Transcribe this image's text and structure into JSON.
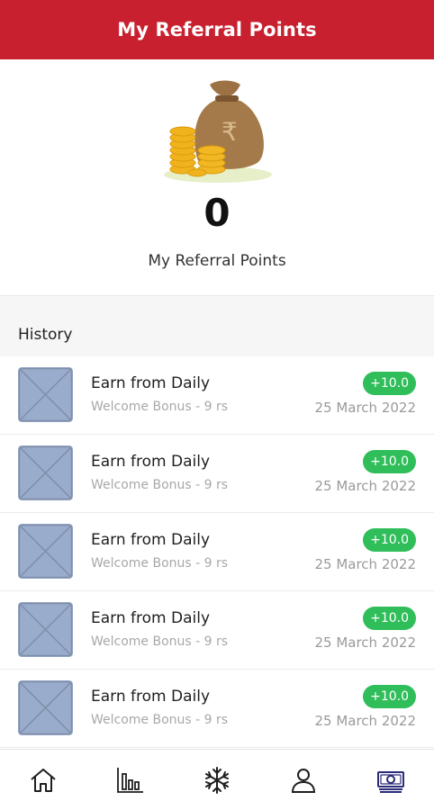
{
  "app_bar": {
    "title": "My Referral Points"
  },
  "summary": {
    "points": "0",
    "label": "My Referral Points"
  },
  "history": {
    "heading": "History",
    "items": [
      {
        "title": "Earn from Daily",
        "subtitle": "Welcome Bonus - 9 rs",
        "amount": "+10.0",
        "date": "25 March 2022"
      },
      {
        "title": "Earn from Daily",
        "subtitle": "Welcome Bonus - 9 rs",
        "amount": "+10.0",
        "date": "25 March 2022"
      },
      {
        "title": "Earn from Daily",
        "subtitle": "Welcome Bonus - 9 rs",
        "amount": "+10.0",
        "date": "25 March 2022"
      },
      {
        "title": "Earn from Daily",
        "subtitle": "Welcome Bonus - 9 rs",
        "amount": "+10.0",
        "date": "25 March 2022"
      },
      {
        "title": "Earn from Daily",
        "subtitle": "Welcome Bonus - 9 rs",
        "amount": "+10.0",
        "date": "25 March 2022"
      }
    ]
  },
  "bottom_nav": {
    "items": [
      {
        "icon": "home-icon",
        "active": false
      },
      {
        "icon": "bar-chart-icon",
        "active": false
      },
      {
        "icon": "snowflake-icon",
        "active": false
      },
      {
        "icon": "user-icon",
        "active": false
      },
      {
        "icon": "cash-icon",
        "active": true
      }
    ]
  },
  "colors": {
    "brand": "#c8202f",
    "badge": "#2fbe5a",
    "active_nav": "#2b2b7a",
    "placeholder": "#9aaccc"
  }
}
